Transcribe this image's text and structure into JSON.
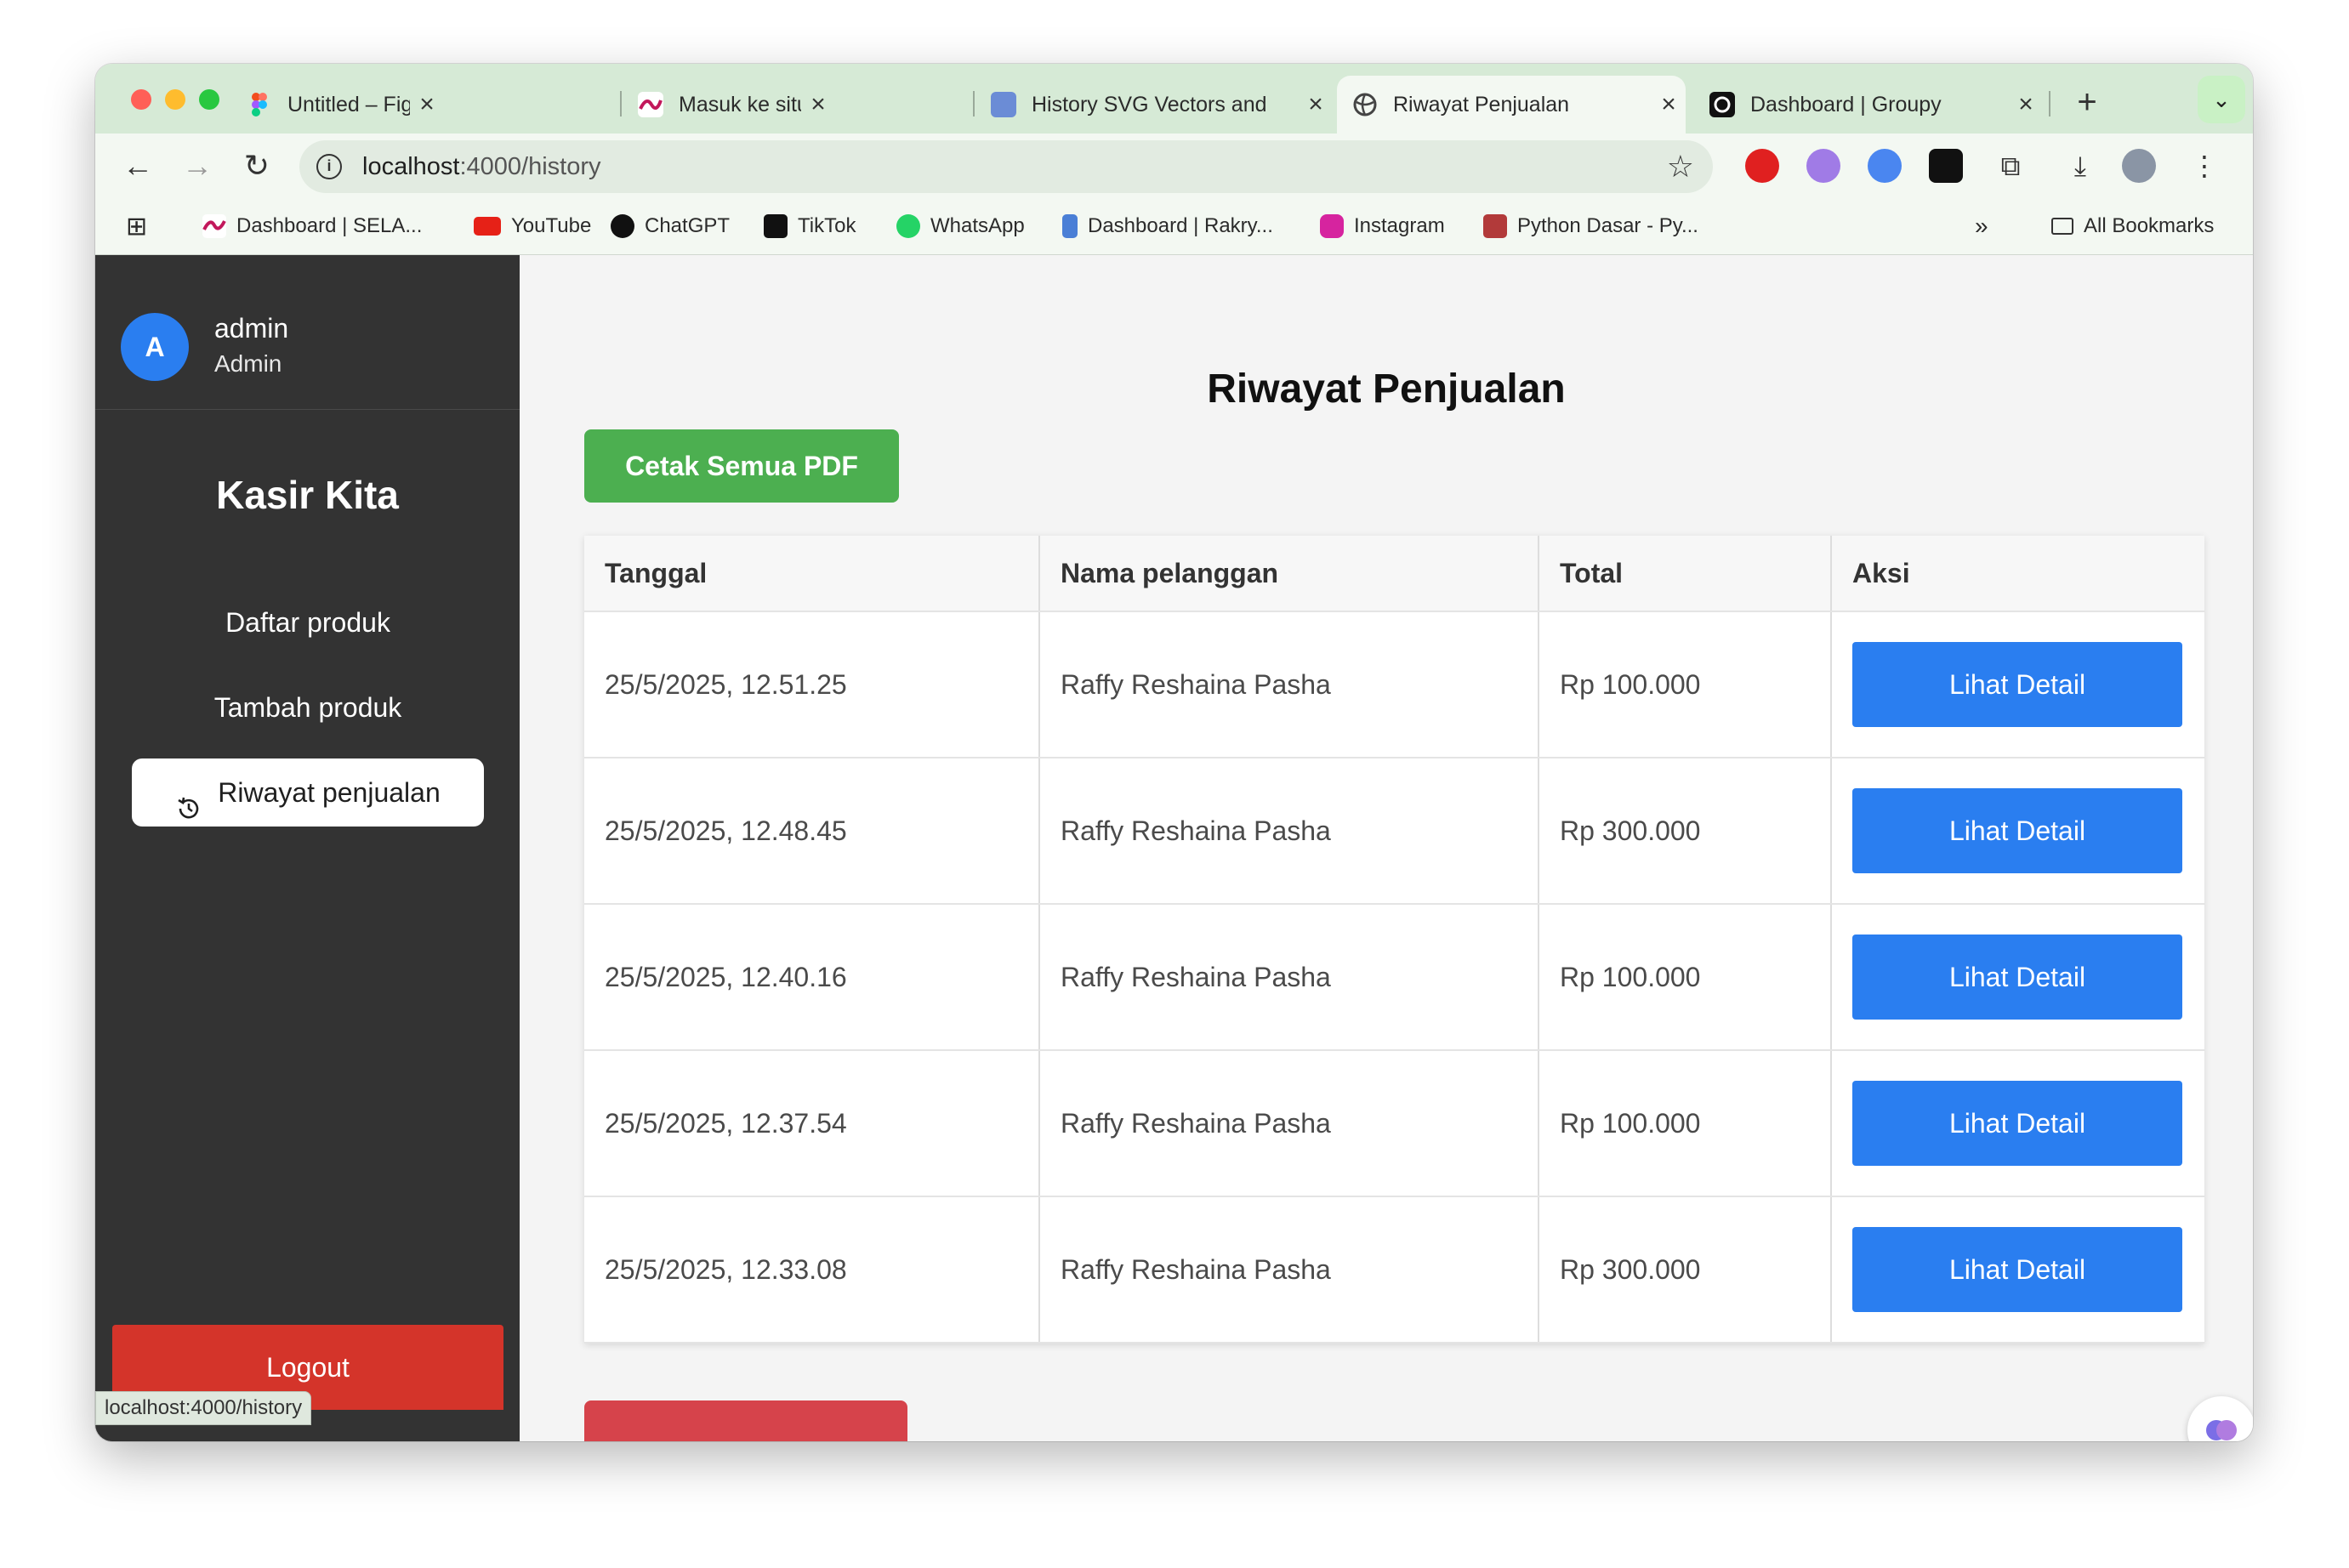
{
  "browser": {
    "tabs": [
      {
        "title": "Untitled – Figma",
        "icon": "figma-icon",
        "active": false
      },
      {
        "title": "Masuk ke situs | SeLAPAK",
        "icon": "selapak-icon",
        "active": false
      },
      {
        "title": "History SVG Vectors and",
        "icon": "repo-icon",
        "active": false
      },
      {
        "title": "Riwayat Penjualan",
        "icon": "globe-icon",
        "active": true
      },
      {
        "title": "Dashboard | Groupy",
        "icon": "groupy-icon",
        "active": false
      }
    ],
    "url_host": "localhost",
    "url_path": ":4000/history",
    "bookmarks": [
      {
        "label": "Dashboard | SELA...",
        "icon": "selapak-icon"
      },
      {
        "label": "YouTube",
        "icon": "youtube-icon"
      },
      {
        "label": "ChatGPT",
        "icon": "chatgpt-icon"
      },
      {
        "label": "TikTok",
        "icon": "tiktok-icon"
      },
      {
        "label": "WhatsApp",
        "icon": "whatsapp-icon"
      },
      {
        "label": "Dashboard | Rakry...",
        "icon": "rakry-icon"
      },
      {
        "label": "Instagram",
        "icon": "instagram-icon"
      },
      {
        "label": "Python Dasar - Py...",
        "icon": "python-icon"
      }
    ],
    "all_bookmarks": "All Bookmarks",
    "status_url": "localhost:4000/history"
  },
  "sidebar": {
    "avatar_letter": "A",
    "username": "admin",
    "role": "Admin",
    "brand": "Kasir Kita",
    "nav": [
      {
        "label": "Daftar produk",
        "active": false
      },
      {
        "label": "Tambah produk",
        "active": false
      },
      {
        "label": "Riwayat penjualan",
        "active": true
      }
    ],
    "logout": "Logout"
  },
  "main": {
    "title": "Riwayat Penjualan",
    "print_all_label": "Cetak Semua PDF",
    "columns": [
      "Tanggal",
      "Nama pelanggan",
      "Total",
      "Aksi"
    ],
    "rows": [
      {
        "date": "25/5/2025, 12.51.25",
        "customer": "Raffy Reshaina Pasha",
        "total": "Rp 100.000",
        "action": "Lihat Detail"
      },
      {
        "date": "25/5/2025, 12.48.45",
        "customer": "Raffy Reshaina Pasha",
        "total": "Rp 300.000",
        "action": "Lihat Detail"
      },
      {
        "date": "25/5/2025, 12.40.16",
        "customer": "Raffy Reshaina Pasha",
        "total": "Rp 100.000",
        "action": "Lihat Detail"
      },
      {
        "date": "25/5/2025, 12.37.54",
        "customer": "Raffy Reshaina Pasha",
        "total": "Rp 100.000",
        "action": "Lihat Detail"
      },
      {
        "date": "25/5/2025, 12.33.08",
        "customer": "Raffy Reshaina Pasha",
        "total": "Rp 300.000",
        "action": "Lihat Detail"
      }
    ]
  },
  "colors": {
    "sidebar_bg": "#333333",
    "accent_blue": "#2a7ef0",
    "pdf_green": "#4caf50",
    "logout_red": "#d4342a"
  }
}
